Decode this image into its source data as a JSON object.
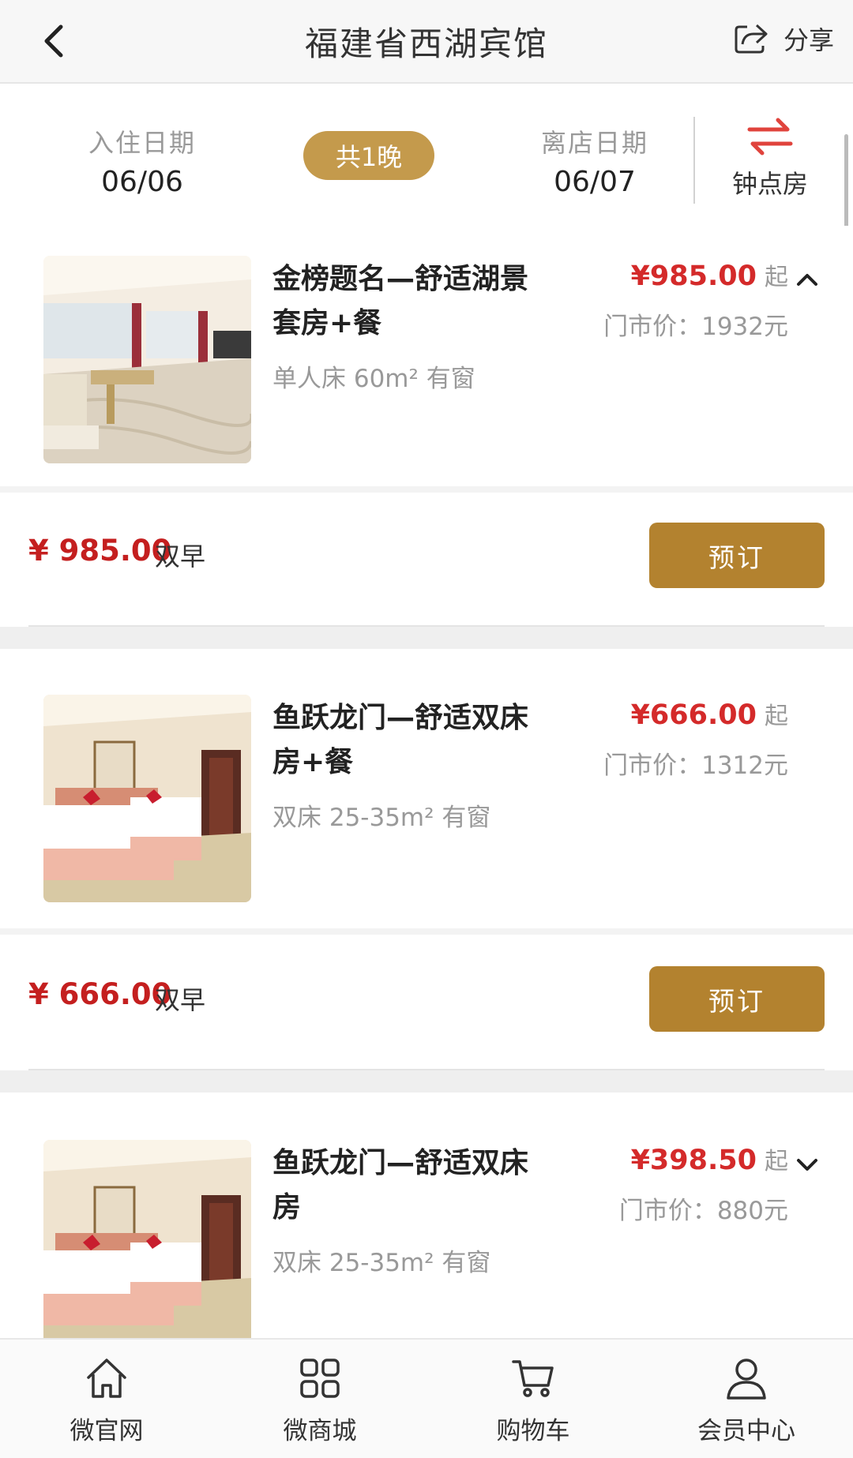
{
  "header": {
    "title": "福建省西湖宾馆",
    "share_label": "分享",
    "back_icon": "chevron-left-icon",
    "share_icon": "share-icon"
  },
  "dates": {
    "checkin_label": "入住日期",
    "checkin_value": "06/06",
    "nights": "共1晚",
    "checkout_label": "离店日期",
    "checkout_value": "06/07",
    "hourly_label": "钟点房",
    "hourly_icon": "swap-arrows-icon"
  },
  "rooms": [
    {
      "name": "金榜题名—舒适湖景套房+餐",
      "spec": "单人床 60m² 有窗",
      "price": "¥985.00",
      "from": "起",
      "market": "门市价：1932元",
      "expanded": true,
      "rate": {
        "amount": "¥ 985.00",
        "meal": "双早",
        "book": "预订"
      }
    },
    {
      "name": "鱼跃龙门—舒适双床房+餐",
      "spec": "双床 25-35m² 有窗",
      "price": "¥666.00",
      "from": "起",
      "market": "门市价：1312元",
      "expanded": true,
      "rate": {
        "amount": "¥ 666.00",
        "meal": "双早",
        "book": "预订"
      }
    },
    {
      "name": "鱼跃龙门—舒适双床房",
      "spec": "双床 25-35m² 有窗",
      "price": "¥398.50",
      "from": "起",
      "market": "门市价：880元",
      "expanded": false
    }
  ],
  "tabbar": [
    {
      "label": "微官网",
      "icon": "home-icon"
    },
    {
      "label": "微商城",
      "icon": "grid-icon"
    },
    {
      "label": "购物车",
      "icon": "cart-icon"
    },
    {
      "label": "会员中心",
      "icon": "user-icon"
    }
  ],
  "colors": {
    "accent_gold": "#c49a4c",
    "button_gold": "#b3822f",
    "price_red": "#d42a2a"
  }
}
